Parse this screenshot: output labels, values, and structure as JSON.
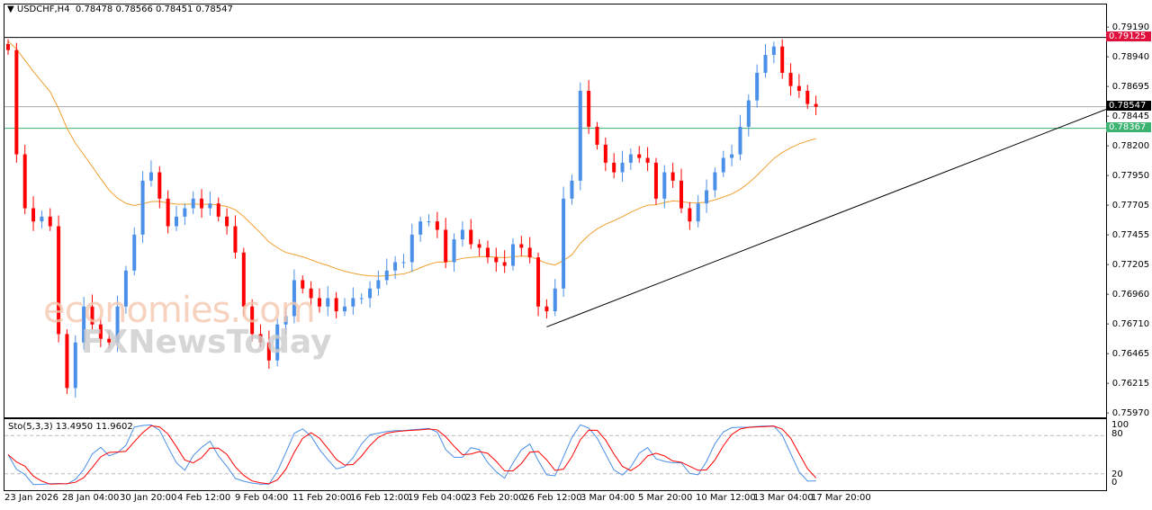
{
  "header": {
    "symbol": "USDCHF,H4",
    "ohlc": "0.78478 0.78566 0.78451 0.78547"
  },
  "stoch": {
    "label": "Sto(5,3,3) 13.4950 11.9602",
    "levels": [
      "100",
      "80",
      "20",
      "0"
    ]
  },
  "watermark": {
    "line1": "economies.com",
    "line2": "FXNewsToday"
  },
  "chart_data": {
    "type": "candlestick",
    "title": "USDCHF,H4",
    "ylim": [
      0.7597,
      0.7919
    ],
    "y_ticks": [
      "0.79190",
      "0.78940",
      "0.78695",
      "0.78445",
      "0.78200",
      "0.77950",
      "0.77705",
      "0.77455",
      "0.77205",
      "0.76960",
      "0.76710",
      "0.76465",
      "0.76215",
      "0.75970"
    ],
    "x_ticks": [
      "23 Jan 2026",
      "28 Jan 04:00",
      "30 Jan 20:00",
      "4 Feb 12:00",
      "9 Feb 04:00",
      "11 Feb 20:00",
      "16 Feb 12:00",
      "19 Feb 04:00",
      "23 Feb 20:00",
      "26 Feb 12:00",
      "3 Mar 04:00",
      "5 Mar 20:00",
      "10 Mar 12:00",
      "13 Mar 04:00",
      "17 Mar 20:00"
    ],
    "closes": [
      0.7902,
      0.7815,
      0.777,
      0.7759,
      0.7763,
      0.7755,
      0.7665,
      0.762,
      0.7658,
      0.7688,
      0.7673,
      0.7661,
      0.7658,
      0.7688,
      0.7718,
      0.7748,
      0.7793,
      0.78,
      0.7778,
      0.7755,
      0.7763,
      0.777,
      0.7778,
      0.777,
      0.7774,
      0.7763,
      0.7755,
      0.7733,
      0.7688,
      0.7665,
      0.7658,
      0.7643,
      0.7673,
      0.768,
      0.771,
      0.7703,
      0.7695,
      0.7688,
      0.7695,
      0.7684,
      0.7688,
      0.7695,
      0.7695,
      0.7703,
      0.771,
      0.7718,
      0.7725,
      0.7725,
      0.7748,
      0.7759,
      0.7759,
      0.7752,
      0.7725,
      0.7744,
      0.7752,
      0.774,
      0.7737,
      0.7729,
      0.7725,
      0.7722,
      0.774,
      0.7737,
      0.7729,
      0.7688,
      0.7684,
      0.7703,
      0.7778,
      0.7793,
      0.7868,
      0.7838,
      0.7823,
      0.7808,
      0.78,
      0.7808,
      0.7815,
      0.7812,
      0.7808,
      0.7778,
      0.78,
      0.7793,
      0.777,
      0.7759,
      0.7774,
      0.7785,
      0.78,
      0.7812,
      0.7815,
      0.7838,
      0.786,
      0.7883,
      0.7898,
      0.7905,
      0.7883,
      0.7872,
      0.7868,
      0.7857,
      0.78547
    ],
    "hlines": [
      {
        "price": "0.79125",
        "color": "#e0103c"
      },
      {
        "price": "0.78547",
        "color": "#000000"
      },
      {
        "price": "0.78367",
        "color": "#3cb371"
      }
    ],
    "trendline": {
      "from": {
        "index": 64,
        "price": 0.7671
      },
      "to": {
        "index": 142,
        "price": 0.7884
      }
    },
    "colors": {
      "bull": "#4a8fe8",
      "bear": "#ff0000",
      "ma": "#f0a030",
      "k": "#4a8fe8",
      "d": "#ff0000"
    }
  }
}
